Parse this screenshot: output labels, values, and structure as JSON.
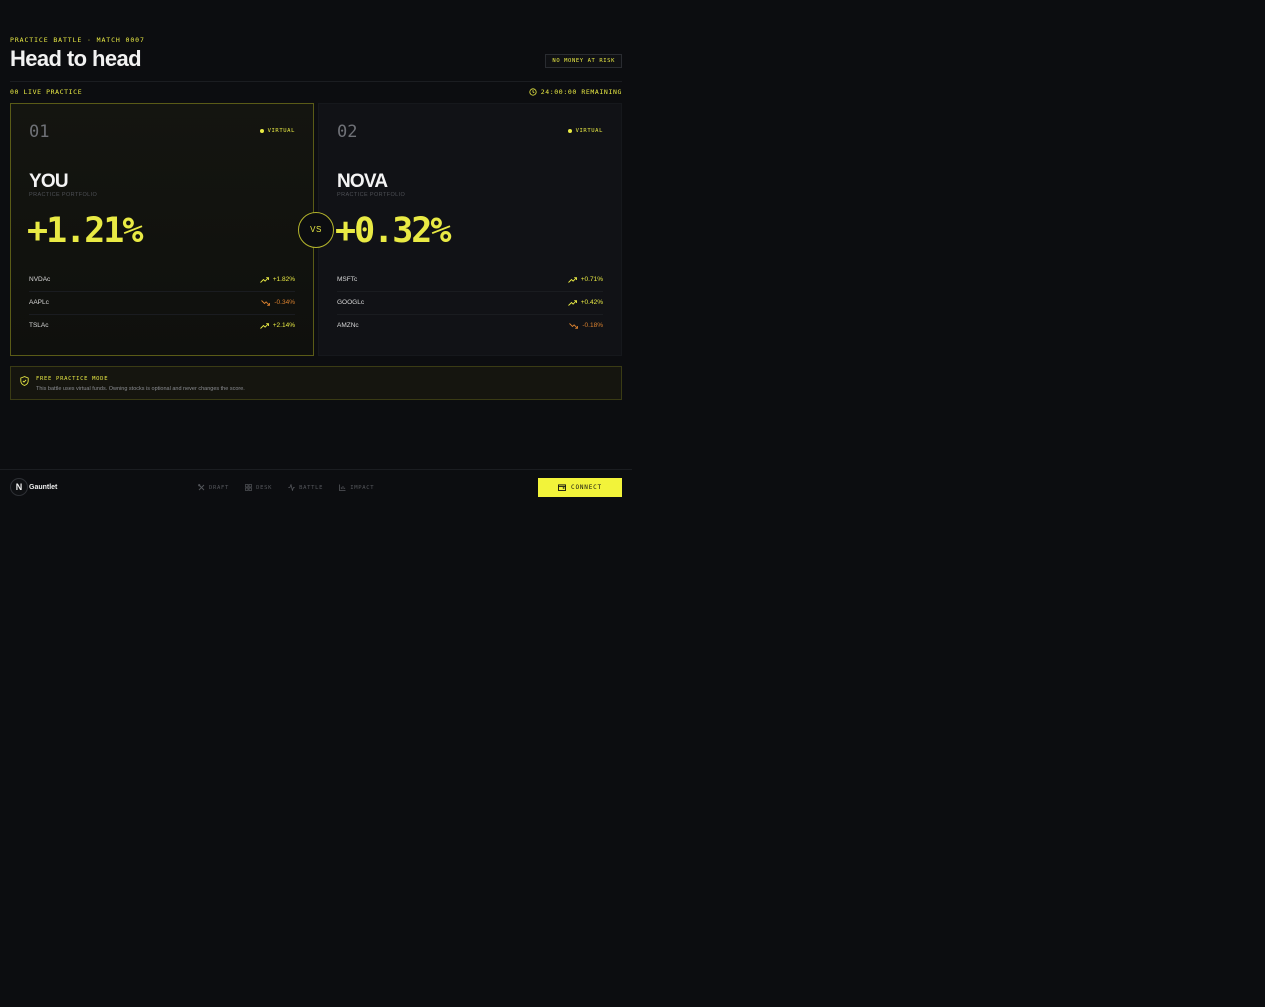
{
  "header": {
    "eyebrow": "PRACTICE BATTLE · MATCH 0007",
    "title": "Head to head",
    "risk_badge": "NO MONEY AT RISK"
  },
  "status": {
    "live_label": "00 LIVE PRACTICE",
    "timer": "24:00:00 REMAINING"
  },
  "players": [
    {
      "number": "01",
      "badge": "VIRTUAL",
      "name": "YOU",
      "subtitle": "PRACTICE PORTFOLIO",
      "performance": "+1.21%",
      "holdings": [
        {
          "ticker": "NVDAc",
          "change": "+1.82%",
          "direction": "up"
        },
        {
          "ticker": "AAPLc",
          "change": "-0.34%",
          "direction": "down"
        },
        {
          "ticker": "TSLAc",
          "change": "+2.14%",
          "direction": "up"
        }
      ]
    },
    {
      "number": "02",
      "badge": "VIRTUAL",
      "name": "NOVA",
      "subtitle": "PRACTICE PORTFOLIO",
      "performance": "+0.32%",
      "holdings": [
        {
          "ticker": "MSFTc",
          "change": "+0.71%",
          "direction": "up"
        },
        {
          "ticker": "GOOGLc",
          "change": "+0.42%",
          "direction": "up"
        },
        {
          "ticker": "AMZNc",
          "change": "-0.18%",
          "direction": "down"
        }
      ]
    }
  ],
  "versus": "VS",
  "notice": {
    "title": "FREE PRACTICE MODE",
    "body": "This battle uses virtual funds. Owning stocks is optional and never changes the score."
  },
  "footer": {
    "logo_letter": "N",
    "brand": "Gauntlet",
    "nav": [
      {
        "label": "DRAFT",
        "icon": "draft-icon"
      },
      {
        "label": "DESK",
        "icon": "desk-icon"
      },
      {
        "label": "BATTLE",
        "icon": "battle-icon"
      },
      {
        "label": "IMPACT",
        "icon": "impact-icon"
      }
    ],
    "connect_label": "CONNECT"
  },
  "colors": {
    "accent": "#e9ea44",
    "negative": "#d9812f",
    "background": "#0c0d10"
  }
}
